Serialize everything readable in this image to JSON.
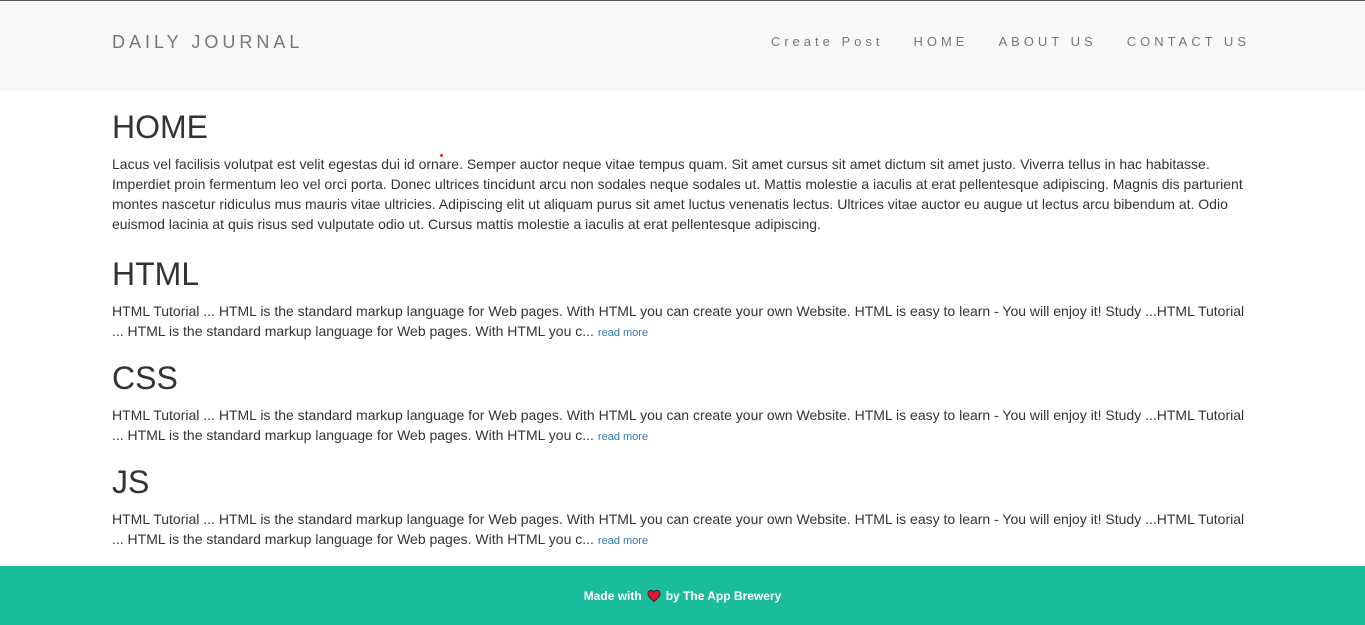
{
  "navbar": {
    "brand": "DAILY JOURNAL",
    "links": [
      "Create Post",
      "HOME",
      "ABOUT US",
      "CONTACT US"
    ]
  },
  "home": {
    "title": "HOME",
    "body": "Lacus vel facilisis volutpat est velit egestas dui id ornare. Semper auctor neque vitae tempus quam. Sit amet cursus sit amet dictum sit amet justo. Viverra tellus in hac habitasse. Imperdiet proin fermentum leo vel orci porta. Donec ultrices tincidunt arcu non sodales neque sodales ut. Mattis molestie a iaculis at erat pellentesque adipiscing. Magnis dis parturient montes nascetur ridiculus mus mauris vitae ultricies. Adipiscing elit ut aliquam purus sit amet luctus venenatis lectus. Ultrices vitae auctor eu augue ut lectus arcu bibendum at. Odio euismod lacinia at quis risus sed vulputate odio ut. Cursus mattis molestie a iaculis at erat pellentesque adipiscing."
  },
  "posts": [
    {
      "title": "HTML",
      "excerpt": "HTML Tutorial ... HTML is the standard markup language for Web pages. With HTML you can create your own Website. HTML is easy to learn - You will enjoy it! Study ...HTML Tutorial ... HTML is the standard markup language for Web pages. With HTML you c...",
      "read_more": "read more"
    },
    {
      "title": "CSS",
      "excerpt": "HTML Tutorial ... HTML is the standard markup language for Web pages. With HTML you can create your own Website. HTML is easy to learn - You will enjoy it! Study ...HTML Tutorial ... HTML is the standard markup language for Web pages. With HTML you c...",
      "read_more": "read more"
    },
    {
      "title": "JS",
      "excerpt": "HTML Tutorial ... HTML is the standard markup language for Web pages. With HTML you can create your own Website. HTML is easy to learn - You will enjoy it! Study ...HTML Tutorial ... HTML is the standard markup language for Web pages. With HTML you c...",
      "read_more": "read more"
    }
  ],
  "footer": {
    "made_with": "Made with",
    "by": "by The App Brewery",
    "icon": "heart-icon",
    "bg_color": "#1abc9c",
    "heart_color": "#e0182d"
  }
}
